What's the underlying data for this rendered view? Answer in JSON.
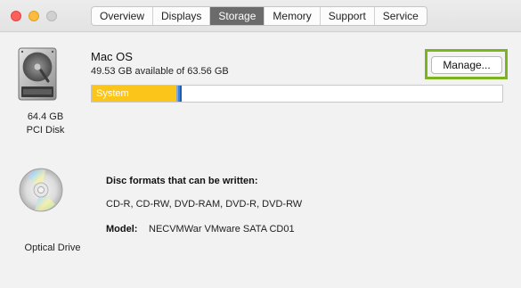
{
  "window": {
    "tabs": [
      {
        "label": "Overview",
        "active": false
      },
      {
        "label": "Displays",
        "active": false
      },
      {
        "label": "Storage",
        "active": true
      },
      {
        "label": "Memory",
        "active": false
      },
      {
        "label": "Support",
        "active": false
      },
      {
        "label": "Service",
        "active": false
      }
    ]
  },
  "disk": {
    "size": "64.4 GB",
    "type": "PCI Disk",
    "icon": "hard-disk-icon"
  },
  "volume": {
    "name": "Mac OS",
    "available": "49.53 GB available of 63.56 GB",
    "usage": {
      "system_label": "System",
      "system_color": "#fbc51a",
      "other_color": "#3a85d8"
    },
    "manage_label": "Manage...",
    "highlight_color": "#7bb41e"
  },
  "optical": {
    "label": "Optical Drive",
    "icon": "optical-disc-icon",
    "formats_title": "Disc formats that can be written:",
    "formats": "CD-R, CD-RW, DVD-RAM, DVD-R, DVD-RW",
    "model_label": "Model:",
    "model_value": "NECVMWar VMware SATA CD01"
  }
}
